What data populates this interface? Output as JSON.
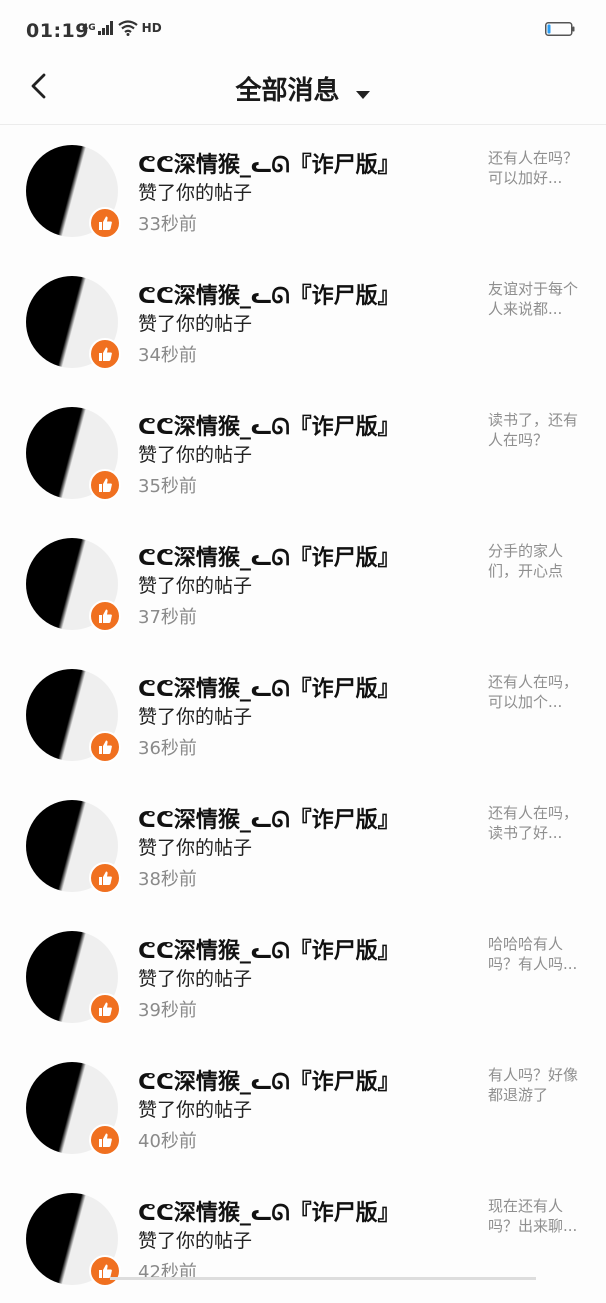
{
  "status_bar": {
    "time": "01:19",
    "network": "4G",
    "hd": "HD"
  },
  "header": {
    "title": "全部消息"
  },
  "messages": [
    {
      "username": "ᕦᕦ深情猴_ᓚᘏ『诈尸版』",
      "action": "赞了你的帖子",
      "time": "33秒前",
      "preview": "还有人在吗？可以加好..."
    },
    {
      "username": "ᕦᕦ深情猴_ᓚᘏ『诈尸版』",
      "action": "赞了你的帖子",
      "time": "34秒前",
      "preview": "友谊对于每个人来说都..."
    },
    {
      "username": "ᕦᕦ深情猴_ᓚᘏ『诈尸版』",
      "action": "赞了你的帖子",
      "time": "35秒前",
      "preview": "读书了，还有人在吗？"
    },
    {
      "username": "ᕦᕦ深情猴_ᓚᘏ『诈尸版』",
      "action": "赞了你的帖子",
      "time": "37秒前",
      "preview": "分手的家人们，开心点"
    },
    {
      "username": "ᕦᕦ深情猴_ᓚᘏ『诈尸版』",
      "action": "赞了你的帖子",
      "time": "36秒前",
      "preview": "还有人在吗，可以加个..."
    },
    {
      "username": "ᕦᕦ深情猴_ᓚᘏ『诈尸版』",
      "action": "赞了你的帖子",
      "time": "38秒前",
      "preview": "还有人在吗，读书了好..."
    },
    {
      "username": "ᕦᕦ深情猴_ᓚᘏ『诈尸版』",
      "action": "赞了你的帖子",
      "time": "39秒前",
      "preview": "哈哈哈有人吗？有人吗..."
    },
    {
      "username": "ᕦᕦ深情猴_ᓚᘏ『诈尸版』",
      "action": "赞了你的帖子",
      "time": "40秒前",
      "preview": "有人吗？好像都退游了"
    },
    {
      "username": "ᕦᕦ深情猴_ᓚᘏ『诈尸版』",
      "action": "赞了你的帖子",
      "time": "42秒前",
      "preview": "现在还有人吗？出来聊..."
    }
  ],
  "colors": {
    "accent": "#f07020",
    "muted": "#8a8a8a"
  }
}
